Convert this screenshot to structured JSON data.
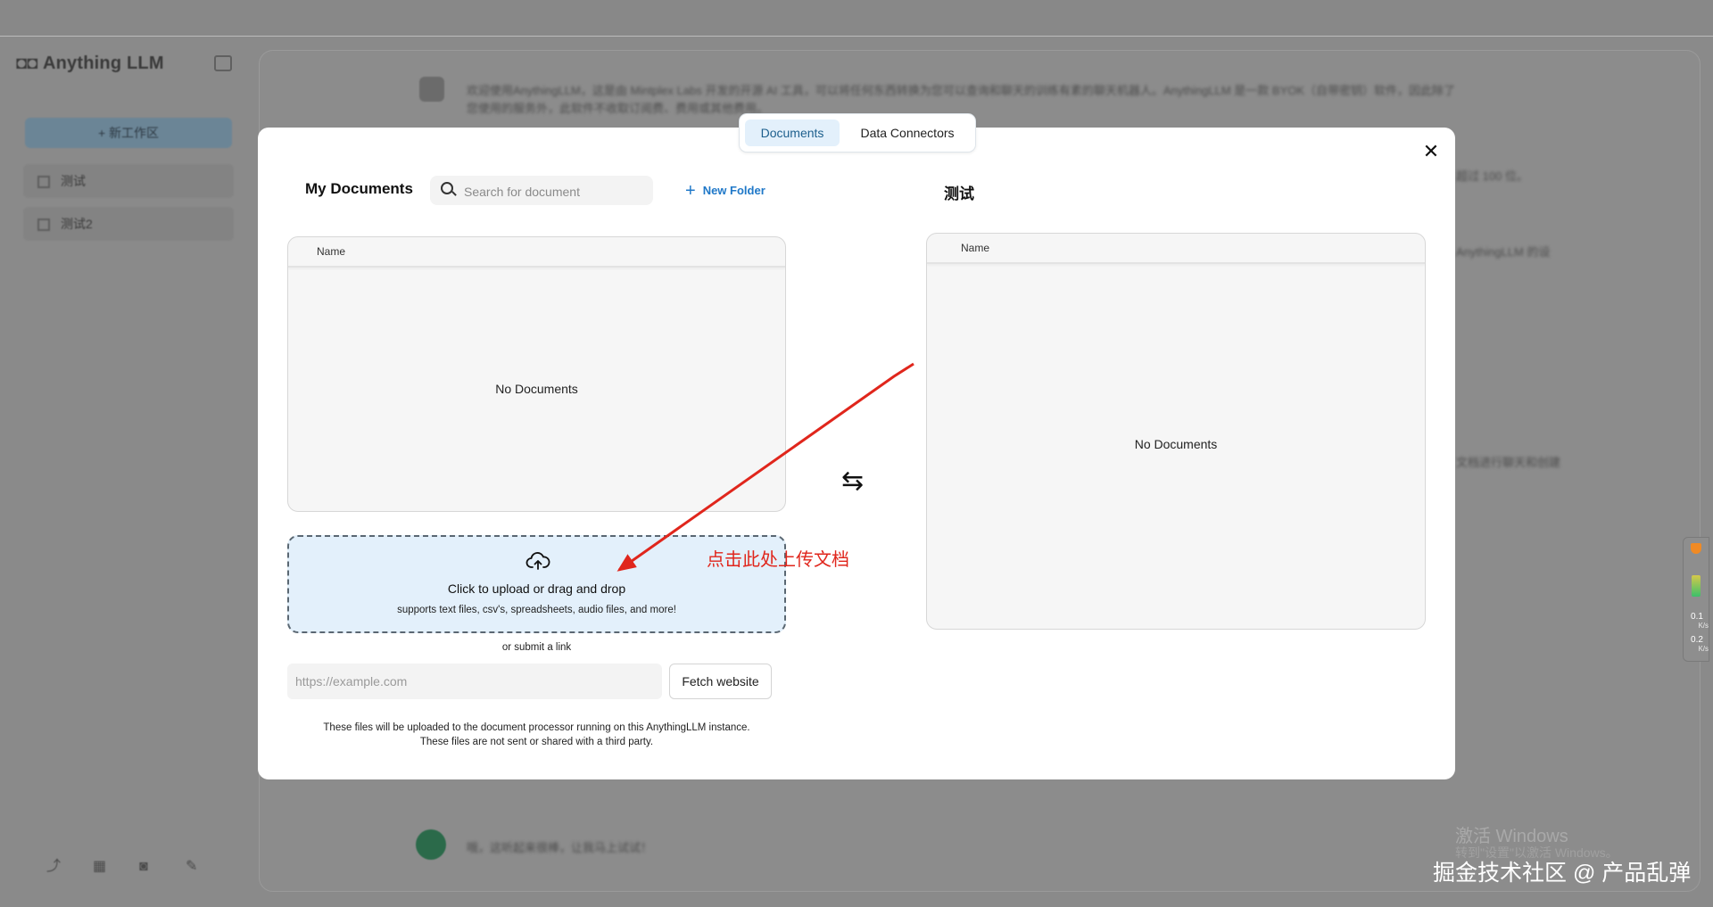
{
  "app": {
    "brand": "Anything LLM",
    "new_workspace": "+ 新工作区",
    "workspaces": [
      "测试",
      "测试2"
    ]
  },
  "chat": {
    "bot_message": "欢迎使用AnythingLLM，这是由 Mintplex Labs 开发的开源 AI 工具，可以将任何东西转换为您可以查询和聊天的训练有素的聊天机器人。AnythingLLM 是一款 BYOK（自带密钥）软件，因此除了",
    "bot_message_2": "您使用的服务外，此软件不收取订阅费、费用或其他费用。",
    "line_b": "超过 100 位。",
    "line_c": "AnythingLLM 的设",
    "line_d": "文档进行聊天和创建",
    "user_message": "哦，这听起来很棒，让我马上试试！"
  },
  "modal": {
    "tabs": [
      {
        "label": "Documents",
        "active": true
      },
      {
        "label": "Data Connectors",
        "active": false
      }
    ],
    "my_documents": {
      "title": "My Documents",
      "search_placeholder": "Search for document",
      "new_folder": "New Folder",
      "column_name": "Name",
      "empty": "No Documents"
    },
    "workspace": {
      "title": "测试",
      "column_name": "Name",
      "empty": "No Documents"
    },
    "upload": {
      "title": "Click to upload or drag and drop",
      "subtitle": "supports text files, csv's, spreadsheets, audio files, and more!",
      "or_link": "or submit a link",
      "url_placeholder": "https://example.com",
      "fetch_button": "Fetch website",
      "disclaimer_1": "These files will be uploaded to the document processor running on this AnythingLLM instance.",
      "disclaimer_2": "These files are not sent or shared with a third party."
    }
  },
  "annotation": {
    "text": "点击此处上传文档",
    "color": "#e0261c"
  },
  "overlay": {
    "windows_activate": "激活 Windows",
    "windows_activate_sub": "转到\"设置\"以激活 Windows。",
    "credit": "掘金技术社区 @ 产品乱弹",
    "net_up": "0.1",
    "net_down": "0.2",
    "net_unit": "K/s"
  },
  "colors": {
    "accent": "#1f78c8",
    "tab_active_bg": "#e3f0fb",
    "dropzone_bg": "#e3f0fb",
    "annotation": "#e0261c"
  }
}
